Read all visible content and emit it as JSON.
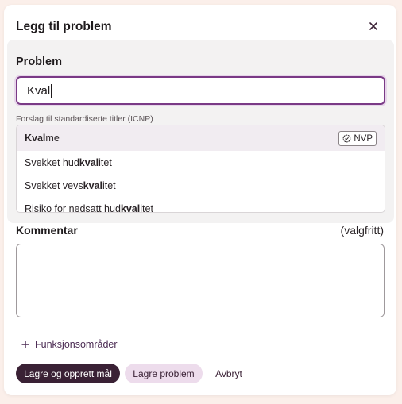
{
  "dialog": {
    "title": "Legg til problem",
    "close_icon": "close-icon"
  },
  "problem": {
    "label": "Problem",
    "input_value": "Kval",
    "suggest_label": "Forslag til standardiserte titler (ICNP)",
    "suggestions": [
      {
        "match": "Kval",
        "pre": "",
        "post": "me",
        "badge": "NVP",
        "badge_icon": "check-badge-icon",
        "highlighted": true
      },
      {
        "pre": "Svekket hud",
        "match": "kval",
        "post": "itet"
      },
      {
        "pre": "Svekket vevs",
        "match": "kval",
        "post": "itet"
      },
      {
        "pre": "Risiko for nedsatt hud",
        "match": "kval",
        "post": "itet"
      }
    ]
  },
  "comment": {
    "label": "Kommentar",
    "optional": "(valgfritt)",
    "value": ""
  },
  "functions": {
    "label": "Funksjonsområder",
    "icon": "plus-icon"
  },
  "actions": {
    "primary": "Lagre og opprett mål",
    "secondary": "Lagre problem",
    "cancel": "Avbryt"
  },
  "colors": {
    "accent": "#7a3a86",
    "primary_button": "#3a2135",
    "secondary_button": "#eddcec",
    "highlight": "#f1ecf1"
  }
}
